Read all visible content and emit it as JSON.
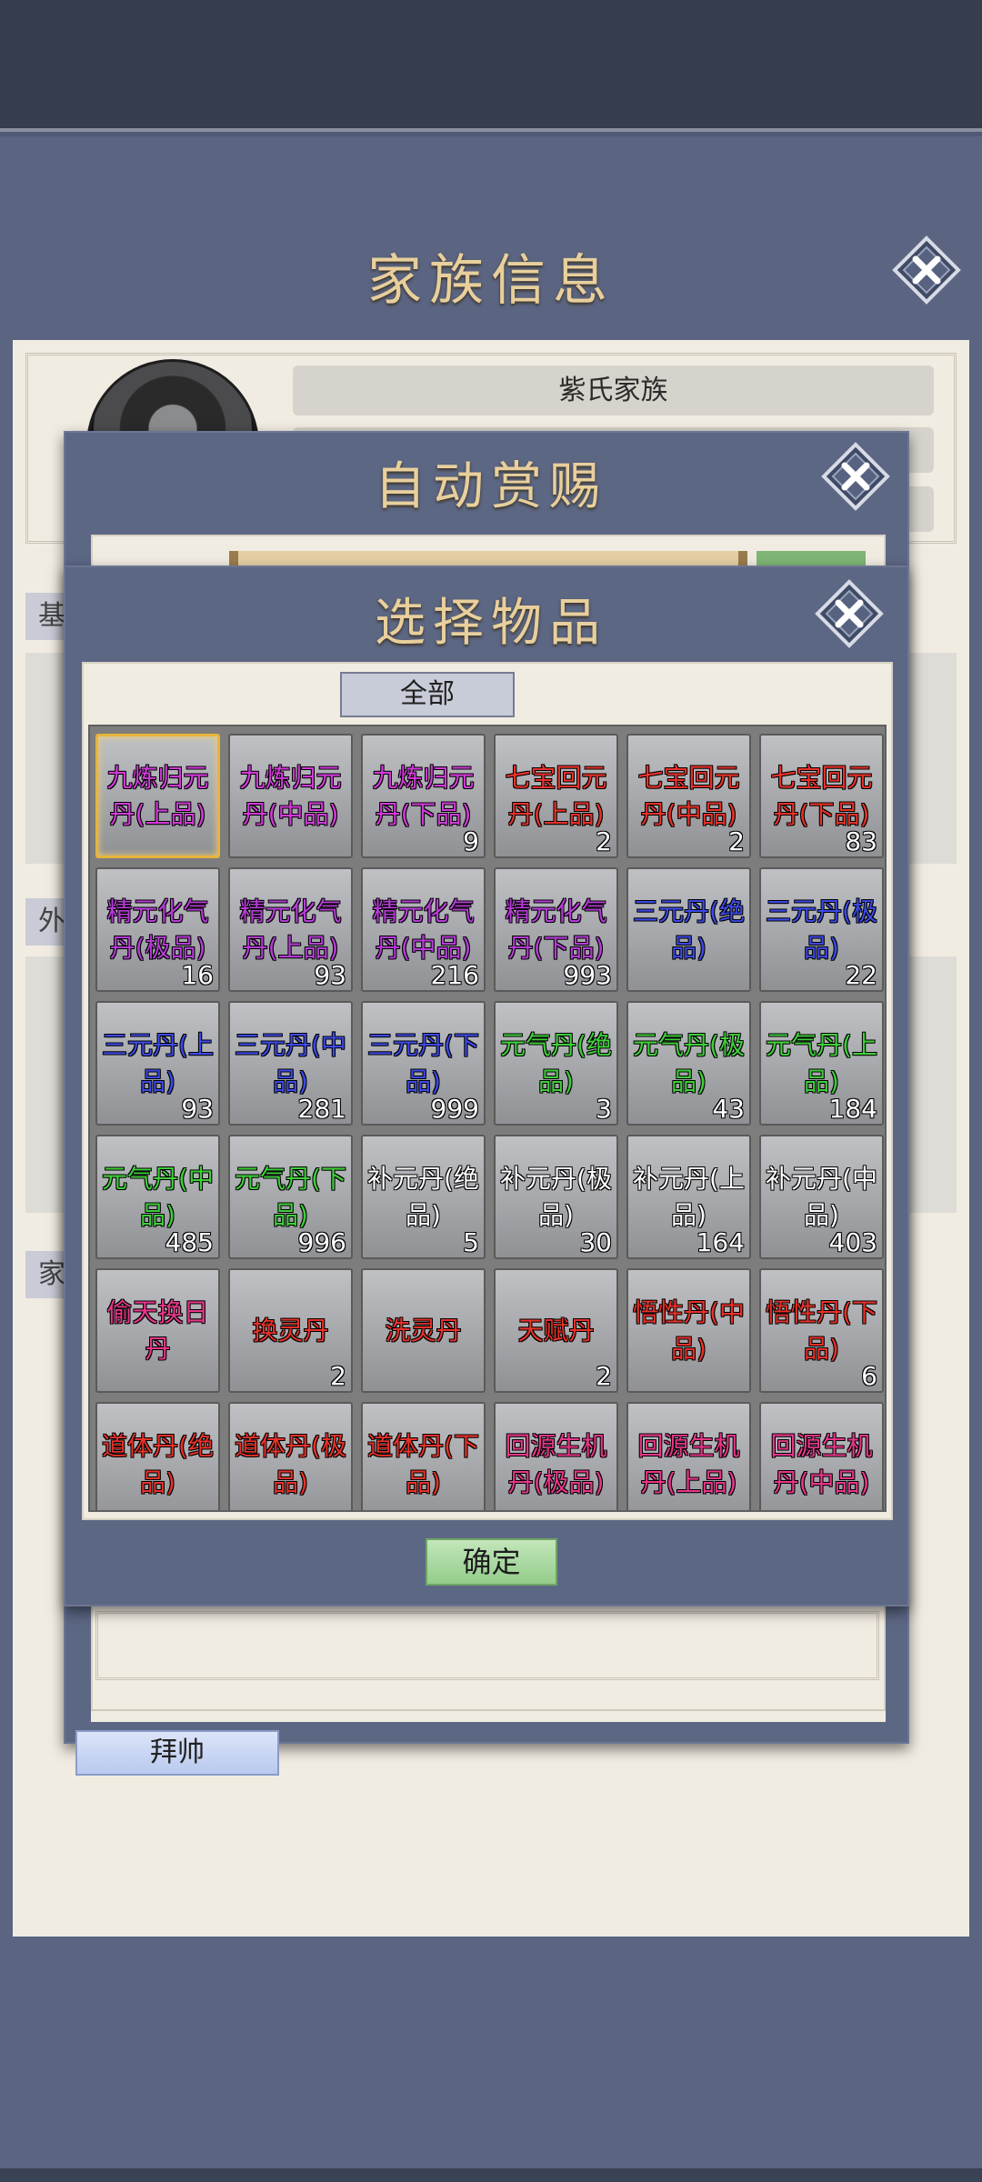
{
  "family_panel": {
    "title": "家族信息",
    "family_name": "紫氏家族",
    "section_tabs": [
      "基",
      "外",
      "家"
    ],
    "bai_shuai_label": "拜帅"
  },
  "reward_panel": {
    "title": "自动赏赐"
  },
  "select_panel": {
    "title": "选择物品",
    "filter_label": "全部",
    "confirm_label": "确定",
    "items": [
      {
        "name": "九炼归元丹(上品)",
        "count": "",
        "color": "#d23ad9"
      },
      {
        "name": "九炼归元丹(中品)",
        "count": "",
        "color": "#d23ad9"
      },
      {
        "name": "九炼归元丹(下品)",
        "count": "9",
        "color": "#d23ad9"
      },
      {
        "name": "七宝回元丹(上品)",
        "count": "2",
        "color": "#e8322a"
      },
      {
        "name": "七宝回元丹(中品)",
        "count": "2",
        "color": "#e8322a"
      },
      {
        "name": "七宝回元丹(下品)",
        "count": "83",
        "color": "#e8322a"
      },
      {
        "name": "精元化气丹(极品)",
        "count": "16",
        "color": "#b53cd6"
      },
      {
        "name": "精元化气丹(上品)",
        "count": "93",
        "color": "#b53cd6"
      },
      {
        "name": "精元化气丹(中品)",
        "count": "216",
        "color": "#b53cd6"
      },
      {
        "name": "精元化气丹(下品)",
        "count": "993",
        "color": "#b53cd6"
      },
      {
        "name": "三元丹(绝品)",
        "count": "",
        "color": "#3d4ae6"
      },
      {
        "name": "三元丹(极品)",
        "count": "22",
        "color": "#3d4ae6"
      },
      {
        "name": "三元丹(上品)",
        "count": "93",
        "color": "#3d4ae6"
      },
      {
        "name": "三元丹(中品)",
        "count": "281",
        "color": "#3d4ae6"
      },
      {
        "name": "三元丹(下品)",
        "count": "999",
        "color": "#3d4ae6"
      },
      {
        "name": "元气丹(绝品)",
        "count": "3",
        "color": "#3fcf3a"
      },
      {
        "name": "元气丹(极品)",
        "count": "43",
        "color": "#3fcf3a"
      },
      {
        "name": "元气丹(上品)",
        "count": "184",
        "color": "#3fcf3a"
      },
      {
        "name": "元气丹(中品)",
        "count": "485",
        "color": "#3fcf3a"
      },
      {
        "name": "元气丹(下品)",
        "count": "996",
        "color": "#3fcf3a"
      },
      {
        "name": "补元丹(绝品)",
        "count": "5",
        "color": "#ffffff"
      },
      {
        "name": "补元丹(极品)",
        "count": "30",
        "color": "#ffffff"
      },
      {
        "name": "补元丹(上品)",
        "count": "164",
        "color": "#ffffff"
      },
      {
        "name": "补元丹(中品)",
        "count": "403",
        "color": "#ffffff"
      },
      {
        "name": "偷天换日丹",
        "count": "",
        "color": "#e8368a"
      },
      {
        "name": "换灵丹",
        "count": "2",
        "color": "#e8322a"
      },
      {
        "name": "洗灵丹",
        "count": "",
        "color": "#e8322a"
      },
      {
        "name": "天赋丹",
        "count": "2",
        "color": "#e8322a"
      },
      {
        "name": "悟性丹(中品)",
        "count": "",
        "color": "#e8322a"
      },
      {
        "name": "悟性丹(下品)",
        "count": "6",
        "color": "#e8322a"
      },
      {
        "name": "道体丹(绝品)",
        "count": "",
        "color": "#e8322a"
      },
      {
        "name": "道体丹(极品)",
        "count": "",
        "color": "#e8322a"
      },
      {
        "name": "道体丹(下品)",
        "count": "",
        "color": "#e8322a"
      },
      {
        "name": "回源生机丹(极品)",
        "count": "",
        "color": "#e8368a"
      },
      {
        "name": "回源生机丹(上品)",
        "count": "",
        "color": "#e8368a"
      },
      {
        "name": "回源生机丹(中品)",
        "count": "",
        "color": "#e8368a"
      }
    ]
  },
  "icons": {
    "close": "close-x-icon"
  }
}
